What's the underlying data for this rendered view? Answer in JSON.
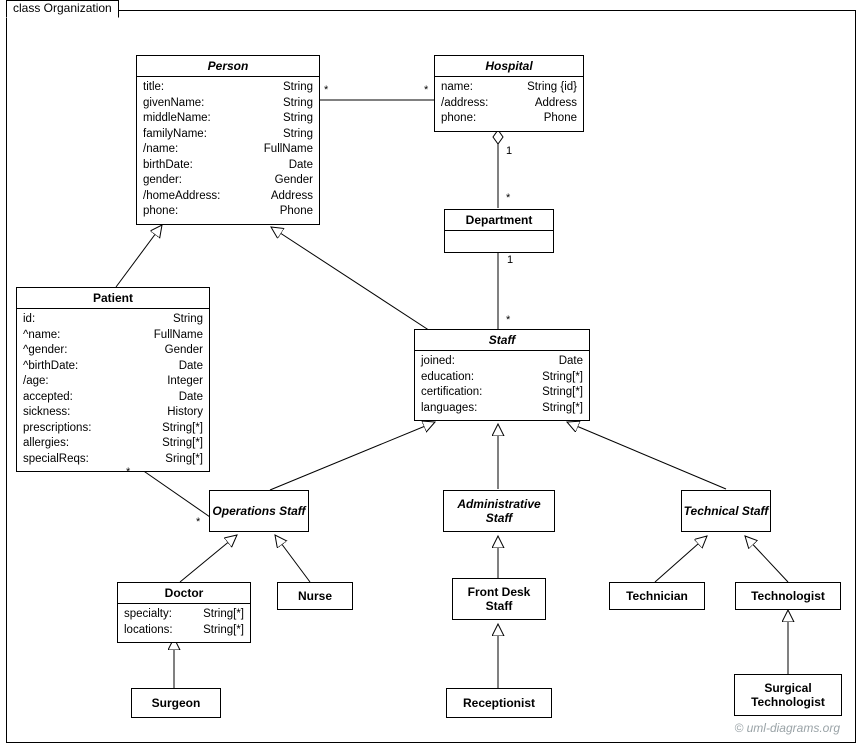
{
  "frame": {
    "label": "class Organization"
  },
  "watermark": "© uml-diagrams.org",
  "classes": {
    "person": {
      "name": "Person",
      "attrs": [
        [
          "title:",
          "String"
        ],
        [
          "givenName:",
          "String"
        ],
        [
          "middleName:",
          "String"
        ],
        [
          "familyName:",
          "String"
        ],
        [
          "/name:",
          "FullName"
        ],
        [
          "birthDate:",
          "Date"
        ],
        [
          "gender:",
          "Gender"
        ],
        [
          "/homeAddress:",
          "Address"
        ],
        [
          "phone:",
          "Phone"
        ]
      ]
    },
    "hospital": {
      "name": "Hospital",
      "attrs": [
        [
          "name:",
          "String {id}"
        ],
        [
          "/address:",
          "Address"
        ],
        [
          "phone:",
          "Phone"
        ]
      ]
    },
    "department": {
      "name": "Department",
      "attrs": []
    },
    "patient": {
      "name": "Patient",
      "attrs": [
        [
          "id:",
          "String"
        ],
        [
          "^name:",
          "FullName"
        ],
        [
          "^gender:",
          "Gender"
        ],
        [
          "^birthDate:",
          "Date"
        ],
        [
          "/age:",
          "Integer"
        ],
        [
          "accepted:",
          "Date"
        ],
        [
          "sickness:",
          "History"
        ],
        [
          "prescriptions:",
          "String[*]"
        ],
        [
          "allergies:",
          "String[*]"
        ],
        [
          "specialReqs:",
          "Sring[*]"
        ]
      ]
    },
    "staff": {
      "name": "Staff",
      "attrs": [
        [
          "joined:",
          "Date"
        ],
        [
          "education:",
          "String[*]"
        ],
        [
          "certification:",
          "String[*]"
        ],
        [
          "languages:",
          "String[*]"
        ]
      ]
    },
    "opsStaff": {
      "name": "Operations Staff"
    },
    "adminStaff": {
      "name": "Administrative Staff"
    },
    "techStaff": {
      "name": "Technical Staff"
    },
    "doctor": {
      "name": "Doctor",
      "attrs": [
        [
          "specialty:",
          "String[*]"
        ],
        [
          "locations:",
          "String[*]"
        ]
      ]
    },
    "nurse": {
      "name": "Nurse"
    },
    "frontDesk": {
      "name": "Front Desk Staff"
    },
    "technician": {
      "name": "Technician"
    },
    "technologist": {
      "name": "Technologist"
    },
    "surgeon": {
      "name": "Surgeon"
    },
    "receptionist": {
      "name": "Receptionist"
    },
    "surgTech": {
      "name": "Surgical Technologist"
    }
  },
  "mult": {
    "ph1": "*",
    "ph2": "*",
    "hd1": "1",
    "hd2": "*",
    "ds1": "1",
    "ds2": "*",
    "po1": "*",
    "po2": "*"
  }
}
